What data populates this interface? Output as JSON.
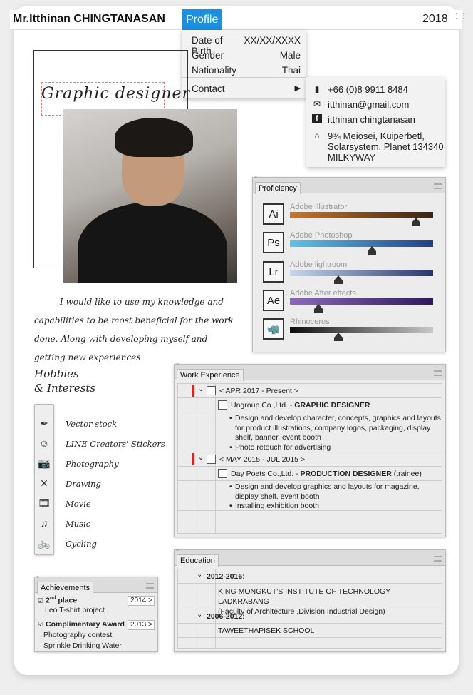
{
  "header": {
    "name": "Mr.Itthinan CHINGTANASAN",
    "profile_tab": "Profile",
    "year": "2018"
  },
  "profile_menu": {
    "items": [
      {
        "label": "Date of Birth",
        "value": "XX/XX/XXXX"
      },
      {
        "label": "Gender",
        "value": "Male"
      },
      {
        "label": "Nationality",
        "value": "Thai"
      }
    ],
    "contact_label": "Contact",
    "contact_arrow": "▶"
  },
  "contact": {
    "phone": "+66 (0)8 9911 8484",
    "email": "itthinan@gmail.com",
    "facebook": "itthinan chingtanasan",
    "address_line1": "9¾ Meiosei, Kuiperbetl,",
    "address_line2": "Solarsystem, Planet 134340",
    "address_line3": "MILKYWAY"
  },
  "title_text": "Graphic designer",
  "intro": "I would like to use my knowledge and capabilities to be most beneficial for the work done. Along with developing myself and getting new experiences.",
  "proficiency": {
    "tab": "Proficiency",
    "skills": [
      {
        "icon": "Ai",
        "name": "Adobe Illustrator",
        "level": 0.88,
        "color_from": "#c8762b",
        "color_to": "#3a2412"
      },
      {
        "icon": "Ps",
        "name": "Adobe Photoshop",
        "level": 0.57,
        "color_from": "#5cc4e4",
        "color_to": "#233f8a"
      },
      {
        "icon": "Lr",
        "name": "Adobe lightroom",
        "level": 0.34,
        "color_from": "#c7d8ea",
        "color_to": "#2a3568"
      },
      {
        "icon": "Ae",
        "name": "Adobe After effects",
        "level": 0.2,
        "color_from": "#8a6ab8",
        "color_to": "#2d1a5a"
      },
      {
        "icon": "rhino",
        "name": "Rhinoceros",
        "level": 0.34,
        "color_from": "#0d0d0d",
        "color_to": "#c8c8c8"
      }
    ]
  },
  "hobbies": {
    "title_line1": "Hobbies",
    "title_line2": "& Interests",
    "items": [
      {
        "icon": "pen-tool-icon",
        "glyph": "✒",
        "label": "Vector stock"
      },
      {
        "icon": "line-sticker-icon",
        "glyph": "☺",
        "label": "LINE Creators' Stickers"
      },
      {
        "icon": "camera-icon",
        "glyph": "📷",
        "label": "Photography"
      },
      {
        "icon": "drawing-tools-icon",
        "glyph": "✕",
        "label": "Drawing"
      },
      {
        "icon": "film-icon",
        "glyph": "🎞",
        "label": "Movie"
      },
      {
        "icon": "music-note-icon",
        "glyph": "♫",
        "label": "Music"
      },
      {
        "icon": "bicycle-icon",
        "glyph": "🚲",
        "label": "Cycling"
      }
    ]
  },
  "achievements": {
    "tab": "Achievements",
    "items": [
      {
        "title": "2",
        "sup": "nd",
        "title_rest": " place",
        "year": "2014",
        "arrow": ">",
        "detail1": "Leo T-shirt project",
        "detail2": ""
      },
      {
        "title": "Complimentary Award",
        "sup": "",
        "title_rest": "",
        "year": "2013",
        "arrow": ">",
        "detail1": "Photography contest",
        "detail2": "Sprinkle Drinking Water"
      }
    ]
  },
  "work": {
    "tab": "Work Experience",
    "jobs": [
      {
        "period": "< APR 2017 - Present >",
        "company": "Ungroup Co.,Ltd. - ",
        "role": "GRAPHIC DESIGNER",
        "role_suffix": "",
        "bullets": [
          "Design and develop character, concepts, graphics and layouts for product illustrations, company logos, packaging, display shelf, banner, event booth",
          "Photo retouch for advertising"
        ]
      },
      {
        "period": "< MAY 2015 - JUL 2015 >",
        "company": "Day Poets Co.,Ltd. - ",
        "role": "PRODUCTION DESIGNER",
        "role_suffix": " (trainee)",
        "bullets": [
          "Design and develop graphics and layouts for magazine, display shelf, event booth",
          "Installing exhibition booth"
        ]
      }
    ]
  },
  "education": {
    "tab": "Education",
    "entries": [
      {
        "period": "2012-2016:",
        "school": "KING MONGKUT'S INSTITUTE OF TECHNOLOGY LADKRABANG",
        "faculty": "(Faculty of Architecture ,Division Industrial Design)"
      },
      {
        "period": "2006-2012:",
        "school": "TAWEETHAPISEK SCHOOL",
        "faculty": ""
      }
    ]
  }
}
